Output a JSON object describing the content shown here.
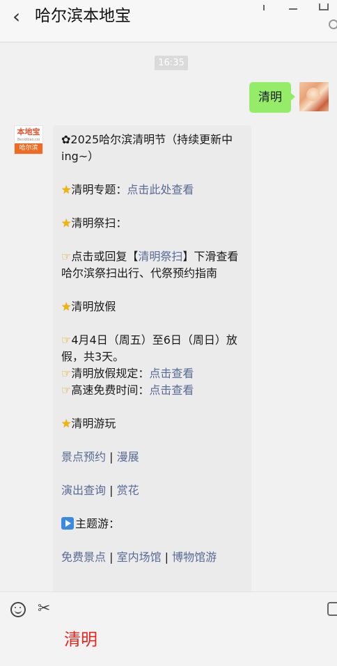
{
  "header": {
    "back_glyph": "‹",
    "title": "哈尔滨本地宝"
  },
  "time_badge": "16:35",
  "my_message": {
    "text": "清明"
  },
  "bot_avatar": {
    "logo_top": "本地宝",
    "logo_mid": "Bendibao.com",
    "logo_bottom": "哈尔滨"
  },
  "bot_message": {
    "headline_icon": "✿",
    "headline": "2025哈尔滨清明节（持续更新中ing~）",
    "topic_label": "清明专题：",
    "topic_link": "点击此处查看",
    "sweep_title": "清明祭扫：",
    "sweep_pre": "点击或回复【",
    "sweep_link": "清明祭扫",
    "sweep_post": "】下滑查看哈尔滨祭扫出行、代祭预约指南",
    "holiday_title": "清明放假",
    "holiday_detail": "4月4日（周五）至6日（周日）放假，共3天。",
    "holiday_rule_label": "清明放假规定：",
    "holiday_rule_link": "点击查看",
    "toll_label": "高速免费时间：",
    "toll_link": "点击查看",
    "play_title": "清明游玩",
    "links_row1": [
      "景点预约",
      "漫展"
    ],
    "links_row2": [
      "演出查询",
      "赏花"
    ],
    "theme_title": "主题游：",
    "links_row3": [
      "免费景点",
      "室内场馆",
      "博物馆游"
    ],
    "separator": " | "
  },
  "input": {
    "text": "清明"
  },
  "icons": [
    "back-icon",
    "pin-icon",
    "minimize-icon",
    "maximize-icon",
    "more-icon",
    "star-icon",
    "point-right-icon",
    "play-icon",
    "smile-icon",
    "scissors-icon",
    "chat-history-icon"
  ],
  "colors": {
    "link": "#576b95",
    "my_bubble": "#95ec69",
    "bot_bubble": "#ebebeb",
    "input_text": "#e8261f"
  }
}
